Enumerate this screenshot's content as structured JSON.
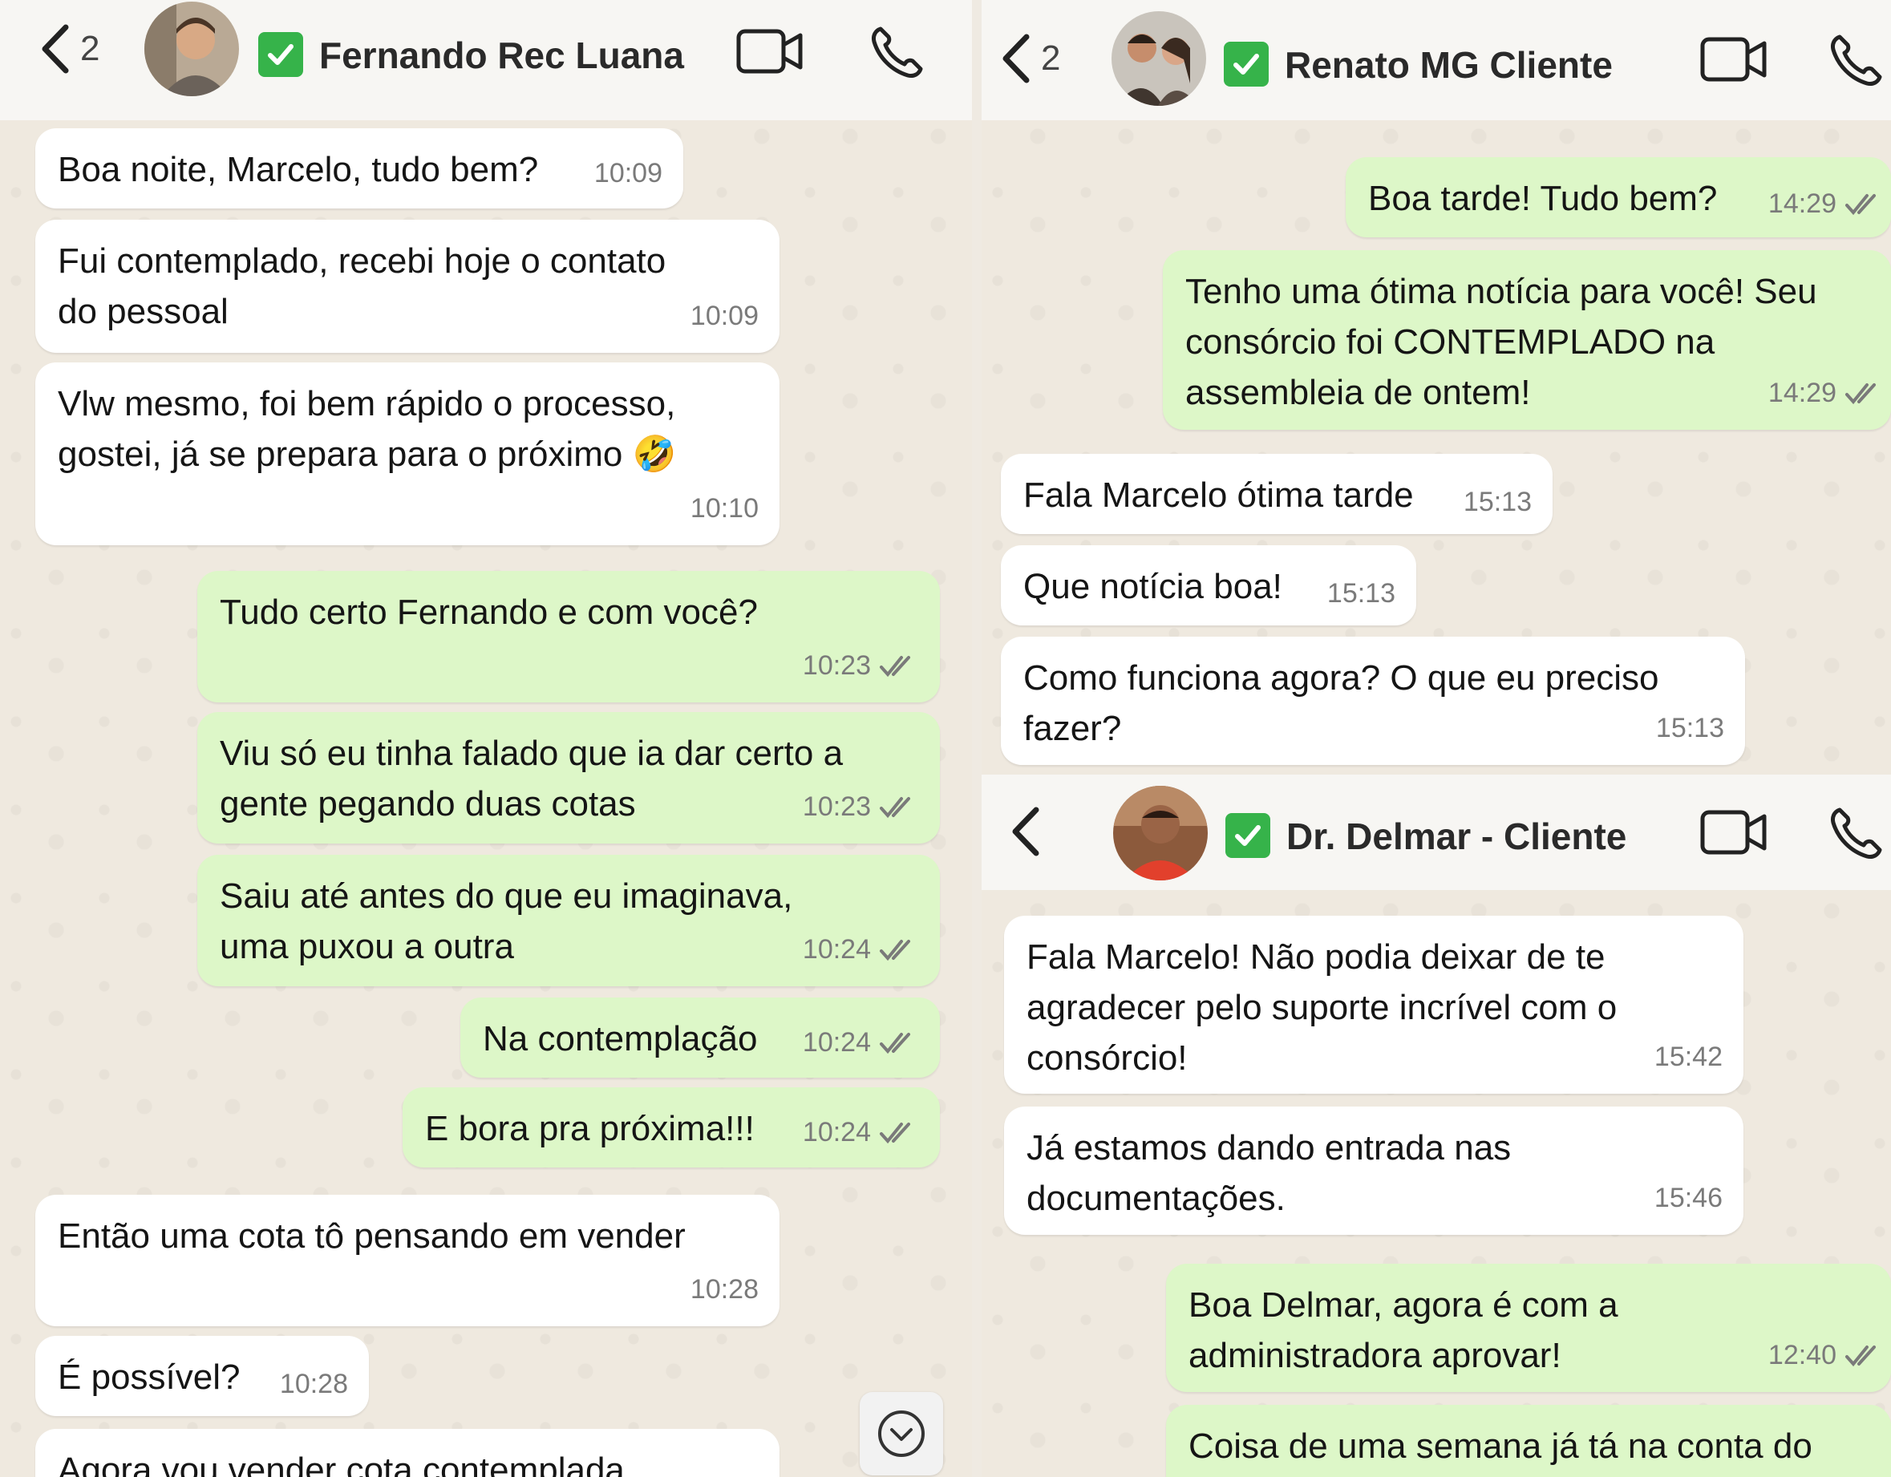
{
  "chat1": {
    "back_count": "2",
    "contact": "Fernando Rec Luana",
    "messages": [
      {
        "text": "Boa noite, Marcelo, tudo bem?",
        "time": "10:09"
      },
      {
        "text": "Fui contemplado, recebi hoje o contato do pessoal",
        "time": "10:09"
      },
      {
        "text": "Vlw mesmo, foi bem rápido o processo, gostei, já se prepara para o próximo 🤣",
        "time": "10:10"
      },
      {
        "text": "Tudo certo Fernando e com você?",
        "time": "10:23"
      },
      {
        "text": "Viu só eu tinha falado que ia dar certo a gente pegando duas cotas",
        "time": "10:23"
      },
      {
        "text": "Saiu até antes do que eu imaginava, uma puxou a outra",
        "time": "10:24"
      },
      {
        "text": "Na contemplação",
        "time": "10:24"
      },
      {
        "text": "E bora pra próxima!!!",
        "time": "10:24"
      },
      {
        "text": "Então uma cota tô pensando em vender",
        "time": "10:28"
      },
      {
        "text": "É possível?",
        "time": "10:28"
      },
      {
        "text": "Agora vou vender cota contemplada",
        "time": ""
      }
    ]
  },
  "chat2": {
    "back_count": "2",
    "contact": "Renato MG Cliente",
    "messages": [
      {
        "text": "Boa tarde! Tudo bem?",
        "time": "14:29"
      },
      {
        "text": "Tenho uma ótima notícia para você! Seu consórcio foi CONTEMPLADO na assembleia de ontem!",
        "time": "14:29"
      },
      {
        "text": "Fala Marcelo ótima tarde",
        "time": "15:13"
      },
      {
        "text": "Que notícia boa!",
        "time": "15:13"
      },
      {
        "text": "Como funciona agora? O que eu preciso fazer?",
        "time": "15:13"
      }
    ]
  },
  "chat3": {
    "contact": "Dr. Delmar - Cliente",
    "messages": [
      {
        "text": "Fala Marcelo! Não podia deixar de te agradecer pelo suporte incrível com o consórcio!",
        "time": "15:42"
      },
      {
        "text": "Já estamos dando entrada nas documentações.",
        "time": "15:46"
      },
      {
        "text": "Boa Delmar, agora é com a administradora aprovar!",
        "time": "12:40"
      },
      {
        "text": "Coisa de uma semana já tá na conta do",
        "time": ""
      }
    ]
  },
  "icons": [
    "chevron-left-icon",
    "video-call-icon",
    "phone-icon",
    "verified-check-icon",
    "double-check-icon",
    "chevron-down-icon"
  ],
  "colors": {
    "incoming": "#ffffff",
    "outgoing": "#ddf7c8",
    "verified": "#36b34a",
    "background": "#efe9df"
  }
}
